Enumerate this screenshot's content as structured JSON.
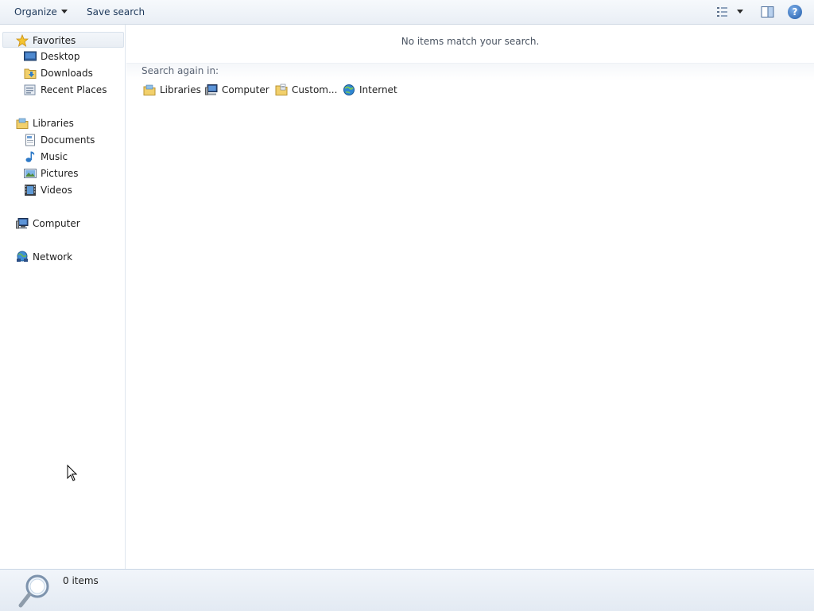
{
  "toolbar": {
    "organize_label": "Organize",
    "save_search_label": "Save search",
    "help_glyph": "?"
  },
  "nav": {
    "favorites": {
      "label": "Favorites",
      "items": [
        {
          "label": "Desktop"
        },
        {
          "label": "Downloads"
        },
        {
          "label": "Recent Places"
        }
      ]
    },
    "libraries": {
      "label": "Libraries",
      "items": [
        {
          "label": "Documents"
        },
        {
          "label": "Music"
        },
        {
          "label": "Pictures"
        },
        {
          "label": "Videos"
        }
      ]
    },
    "computer": {
      "label": "Computer"
    },
    "network": {
      "label": "Network"
    }
  },
  "content": {
    "empty_message": "No items match your search.",
    "search_again_label": "Search again in:",
    "search_again_links": [
      {
        "label": "Libraries",
        "icon": "libraries-icon"
      },
      {
        "label": "Computer",
        "icon": "computer-icon"
      },
      {
        "label": "Custom...",
        "icon": "custom-folder-icon"
      },
      {
        "label": "Internet",
        "icon": "internet-icon"
      }
    ]
  },
  "status": {
    "item_count": "0 items",
    "icon": "search-magnifier-icon"
  },
  "colors": {
    "toolbar_text": "#1e395b",
    "accent": "#1f5aa8"
  }
}
